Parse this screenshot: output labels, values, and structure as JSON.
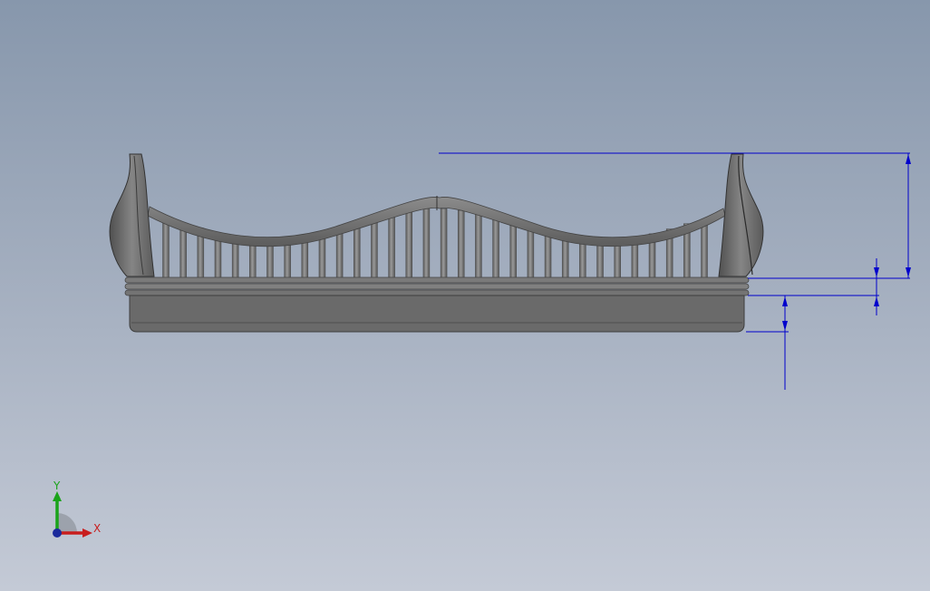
{
  "viewport": {
    "background_top": "#8797ac",
    "background_bottom": "#c4cad6",
    "model_color": "#6d6d6d",
    "model_highlight": "#8e8e8e",
    "model_shadow": "#4a4a4a",
    "dimension_color": "#0000cc"
  },
  "model": {
    "spindle_count": 32
  },
  "triad": {
    "y_label": "Y",
    "x_label": "X",
    "y_color": "#1aa31a",
    "x_color": "#c81e1e",
    "z_color": "#1b2a9c"
  }
}
